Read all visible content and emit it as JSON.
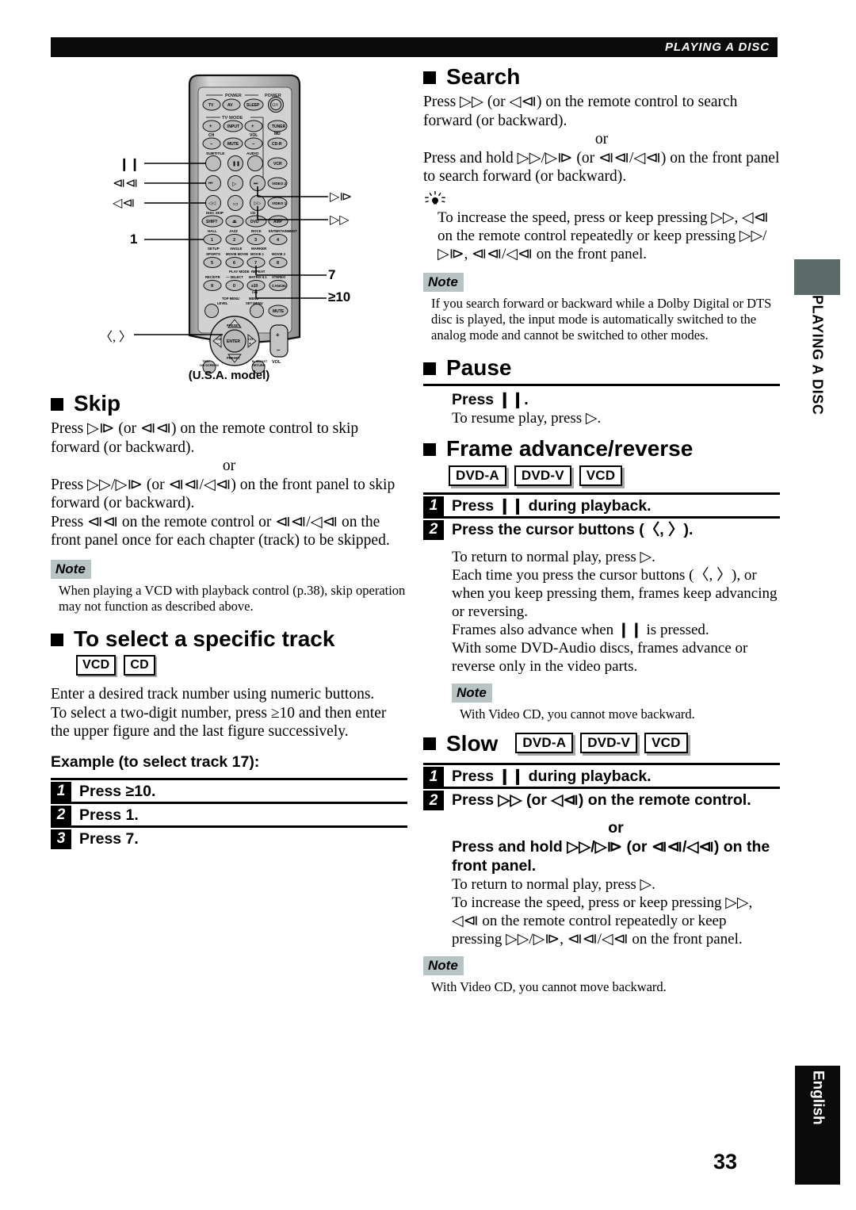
{
  "running_head": "PLAYING A DISC",
  "page_number": "33",
  "side_tab": {
    "chapter": "PLAYING A DISC",
    "language": "English"
  },
  "remote": {
    "caption": "(U.S.A. model)",
    "callouts": [
      {
        "id": "pause",
        "label": "❙❙"
      },
      {
        "id": "skip-back",
        "label": "⧏⧏"
      },
      {
        "id": "search-back",
        "label": "◁⧏"
      },
      {
        "id": "skip-fwd",
        "label": "▷⧐"
      },
      {
        "id": "search-fwd",
        "label": "▷▷"
      },
      {
        "id": "num-1",
        "label": "1"
      },
      {
        "id": "num-7",
        "label": "7"
      },
      {
        "id": "num-ten-plus",
        "label": "≥10"
      },
      {
        "id": "cursor",
        "label": "〈, 〉"
      }
    ]
  },
  "left_column": {
    "skip": {
      "title": "Skip",
      "p1": "Press ▷⧐ (or ⧏⧏) on the remote control to skip forward (or backward).",
      "or": "or",
      "p2": "Press ▷▷/▷⧐ (or ⧏⧏/◁⧏) on the front panel to skip forward (or backward).",
      "p3": "Press ⧏⧏ on the remote control or ⧏⧏/◁⧏ on the front panel once for each chapter (track) to be skipped.",
      "note_label": "Note",
      "note_text": "When playing a VCD with playback control (p.38), skip operation may not function as described above."
    },
    "specific_track": {
      "title": "To select a specific track",
      "badges": [
        "VCD",
        "CD"
      ],
      "p1": "Enter a desired track number using numeric buttons.",
      "p2": "To select a two-digit number, press ≥10 and then enter the upper figure and the last figure successively.",
      "example_heading": "Example (to select track 17):",
      "steps": [
        {
          "num": "1",
          "text": "Press ≥10."
        },
        {
          "num": "2",
          "text": "Press 1."
        },
        {
          "num": "3",
          "text": "Press 7."
        }
      ]
    }
  },
  "right_column": {
    "search": {
      "title": "Search",
      "p1": "Press ▷▷ (or ◁⧏) on the remote control to search forward (or backward).",
      "or": "or",
      "p2": "Press and hold ▷▷/▷⧐ (or ⧏⧏/◁⧏) on the front panel to search forward (or backward).",
      "tip_text": "To increase the speed, press or keep pressing ▷▷, ◁⧏ on the remote control repeatedly or keep pressing ▷▷/▷⧐, ⧏⧏/◁⧏ on the front panel.",
      "note_label": "Note",
      "note_text": "If you search forward or backward while a Dolby Digital or DTS disc is played, the input mode is automatically switched to the analog mode and cannot be switched to other modes."
    },
    "pause": {
      "title": "Pause",
      "press_line": "Press ❙❙.",
      "sub_line": "To resume play, press ▷."
    },
    "frame_advance": {
      "title": "Frame advance/reverse",
      "badges": [
        "DVD-A",
        "DVD-V",
        "VCD"
      ],
      "steps": [
        {
          "num": "1",
          "text": "Press ❙❙ during playback.",
          "subs": []
        },
        {
          "num": "2",
          "text": "Press the cursor buttons (〈, 〉).",
          "subs": [
            "To return to normal play, press ▷.",
            "Each time you press the cursor buttons (〈, 〉), or when you keep pressing them, frames keep advancing or reversing.",
            "Frames also advance when ❙❙ is pressed.",
            "With some DVD-Audio discs, frames advance or reverse only in the video parts."
          ]
        }
      ],
      "note_label": "Note",
      "note_text": "With Video CD, you cannot move backward."
    },
    "slow": {
      "title": "Slow",
      "badges": [
        "DVD-A",
        "DVD-V",
        "VCD"
      ],
      "steps": [
        {
          "num": "1",
          "text": "Press ❙❙ during playback."
        },
        {
          "num": "2",
          "text": "Press ▷▷ (or ◁⧏) on the remote control."
        }
      ],
      "or": "or",
      "press_hold": "Press and hold ▷▷/▷⧐ (or ⧏⧏/◁⧏) on the front panel.",
      "subs": [
        "To return to normal play, press ▷.",
        "To increase the speed, press or keep pressing ▷▷, ◁⧏ on the remote control repeatedly or keep pressing ▷▷/▷⧐, ⧏⧏/◁⧏ on the front panel."
      ],
      "note_label": "Note",
      "note_text": "With Video CD, you cannot move backward."
    }
  }
}
